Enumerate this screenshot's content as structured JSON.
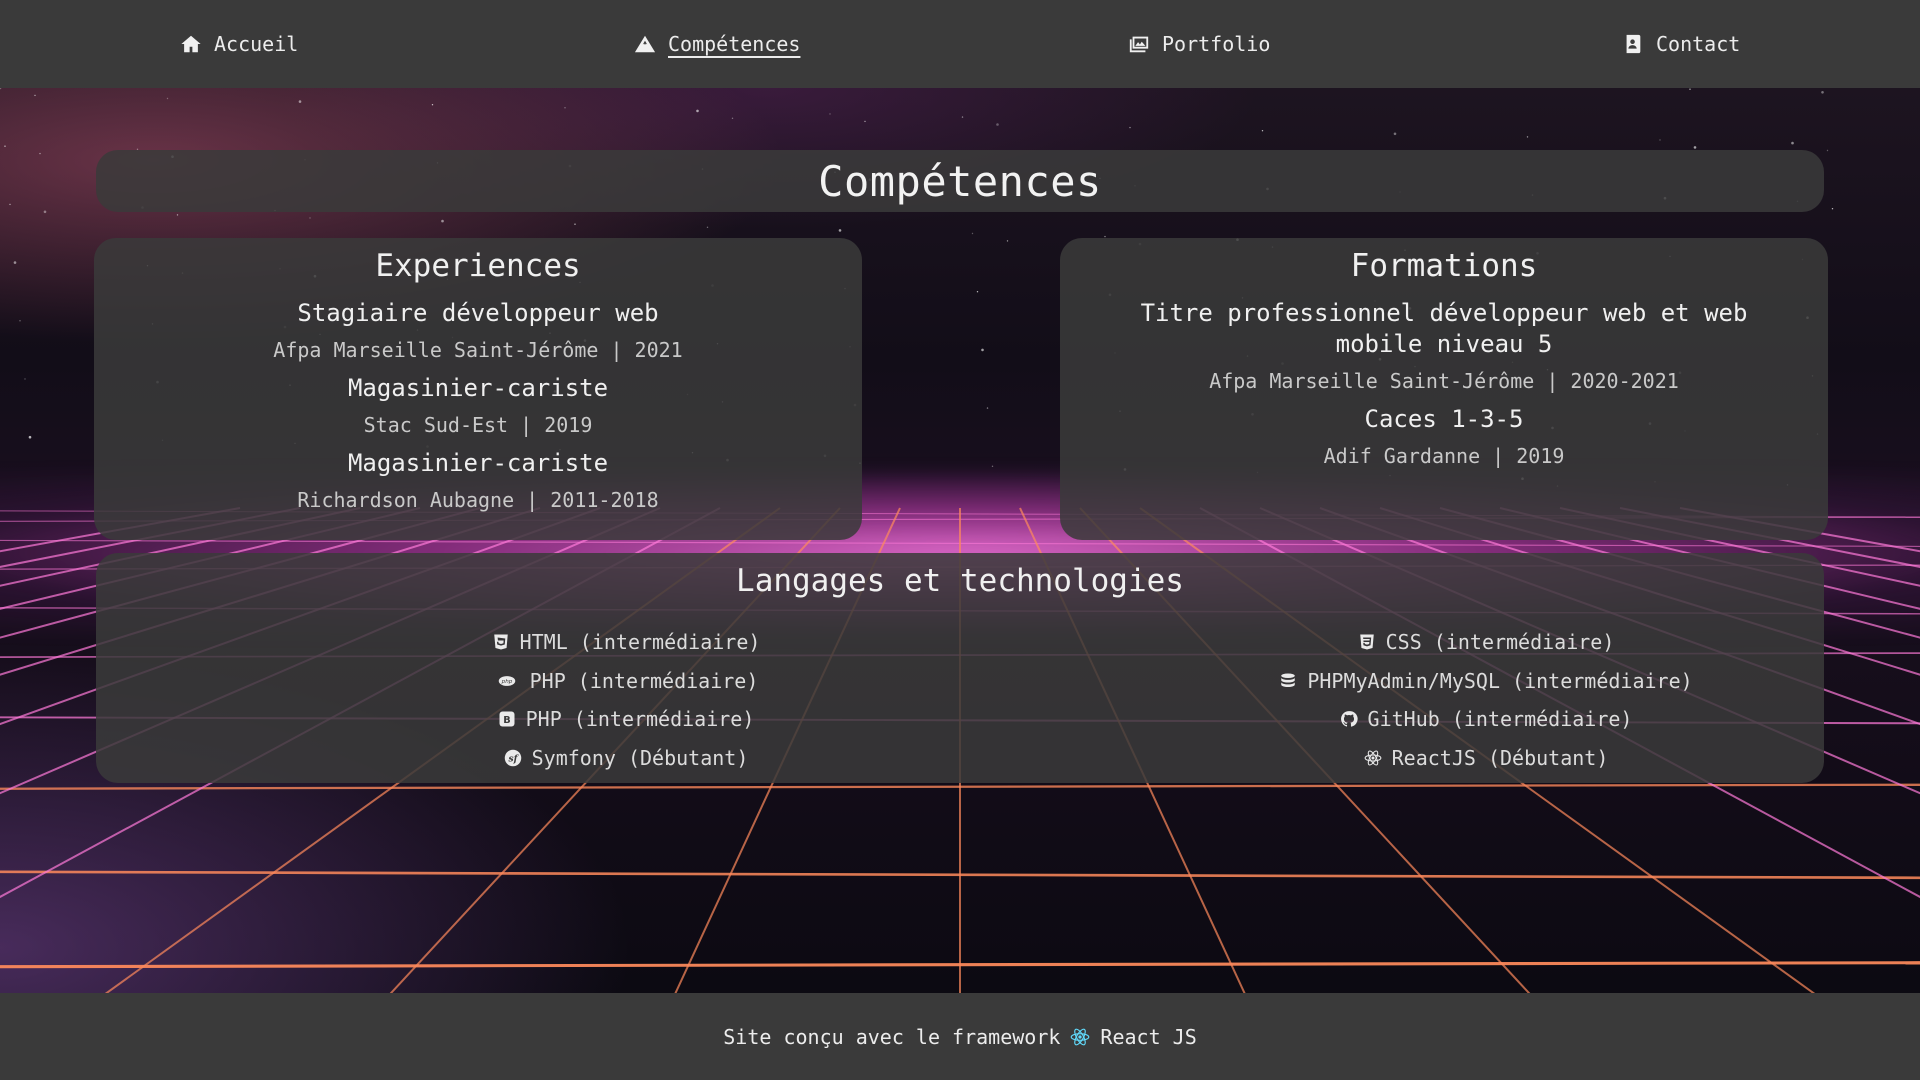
{
  "nav": {
    "items": [
      {
        "label": "Accueil",
        "icon": "home-icon",
        "active": false
      },
      {
        "label": "Compétences",
        "icon": "mountain-icon",
        "active": true
      },
      {
        "label": "Portfolio",
        "icon": "images-icon",
        "active": false
      },
      {
        "label": "Contact",
        "icon": "address-book-icon",
        "active": false
      }
    ]
  },
  "page": {
    "title": "Compétences"
  },
  "experiences": {
    "title": "Experiences",
    "items": [
      {
        "title": "Stagiaire développeur web",
        "subtitle": "Afpa Marseille Saint-Jérôme | 2021"
      },
      {
        "title": "Magasinier-cariste",
        "subtitle": "Stac Sud-Est | 2019"
      },
      {
        "title": "Magasinier-cariste",
        "subtitle": "Richardson Aubagne | 2011-2018"
      }
    ]
  },
  "formations": {
    "title": "Formations",
    "items": [
      {
        "title": "Titre professionnel développeur web et web mobile niveau 5",
        "subtitle": "Afpa Marseille Saint-Jérôme | 2020-2021"
      },
      {
        "title": "Caces 1-3-5",
        "subtitle": "Adif Gardanne | 2019"
      }
    ]
  },
  "technologies": {
    "title": "Langages et technologies",
    "left": [
      {
        "label": "HTML (intermédiaire)",
        "icon": "html5-icon"
      },
      {
        "label": "PHP (intermédiaire)",
        "icon": "php-icon"
      },
      {
        "label": "PHP (intermédiaire)",
        "icon": "bootstrap-icon"
      },
      {
        "label": "Symfony (Débutant)",
        "icon": "symfony-icon"
      }
    ],
    "right": [
      {
        "label": "CSS (intermédiaire)",
        "icon": "css3-icon"
      },
      {
        "label": "PHPMyAdmin/MySQL (intermédiaire)",
        "icon": "database-icon"
      },
      {
        "label": "GitHub (intermédiaire)",
        "icon": "github-icon"
      },
      {
        "label": "ReactJS (Débutant)",
        "icon": "react-icon"
      }
    ]
  },
  "footer": {
    "text": "Site conçu avec le framework",
    "framework": "React JS",
    "icon": "react-icon",
    "icon_color": "#61dafb"
  },
  "colors": {
    "bar_background": "#3a3a3a",
    "panel_background": "rgba(58,58,58,0.86)",
    "grid_pink": "#ff7ad9",
    "grid_orange": "#ff8a5c"
  }
}
